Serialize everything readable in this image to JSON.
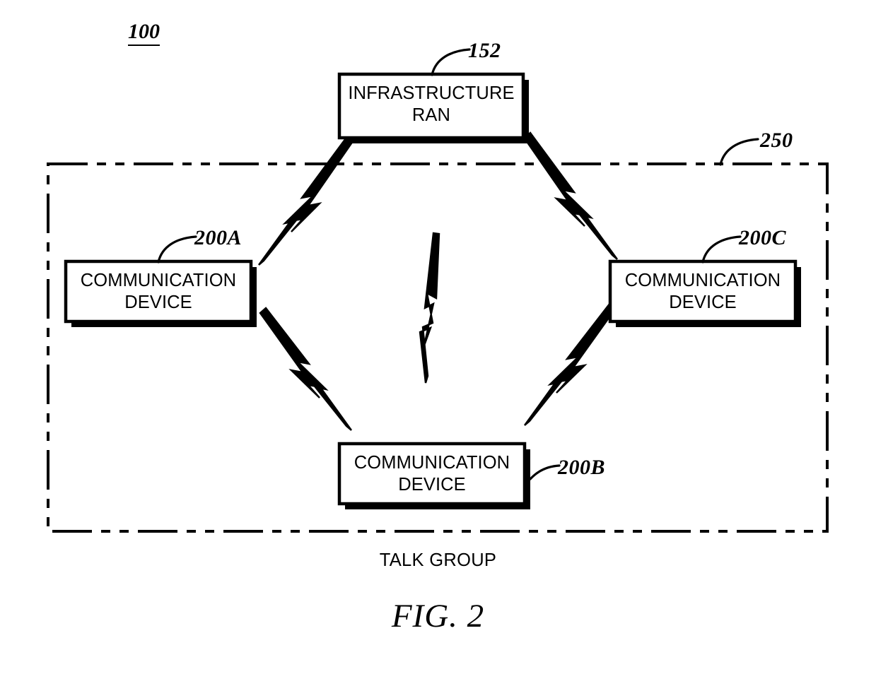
{
  "figure": {
    "system_ref": "100",
    "caption": "FIG. 2"
  },
  "nodes": [
    {
      "id": "infrastructure-ran",
      "label": "INFRASTRUCTURE\nRAN",
      "ref": "152"
    },
    {
      "id": "communication-device-a",
      "label": "COMMUNICATION\nDEVICE",
      "ref": "200A"
    },
    {
      "id": "communication-device-c",
      "label": "COMMUNICATION\nDEVICE",
      "ref": "200C"
    },
    {
      "id": "communication-device-b",
      "label": "COMMUNICATION\nDEVICE",
      "ref": "200B"
    }
  ],
  "boundary": {
    "ref": "250",
    "caption": "TALK GROUP",
    "style": "dash-dot-dot"
  },
  "links": [
    {
      "from": "infrastructure-ran",
      "to": "communication-device-a",
      "type": "wireless-link"
    },
    {
      "from": "infrastructure-ran",
      "to": "communication-device-c",
      "type": "wireless-link"
    },
    {
      "from": "communication-device-a",
      "to": "communication-device-b",
      "type": "wireless-link"
    },
    {
      "from": "communication-device-c",
      "to": "communication-device-b",
      "type": "wireless-link"
    },
    {
      "from": "communication-device-a",
      "to": "communication-device-c",
      "type": "wireless-link-direct"
    }
  ],
  "colors": {
    "ink": "#000000",
    "paper": "#ffffff"
  }
}
